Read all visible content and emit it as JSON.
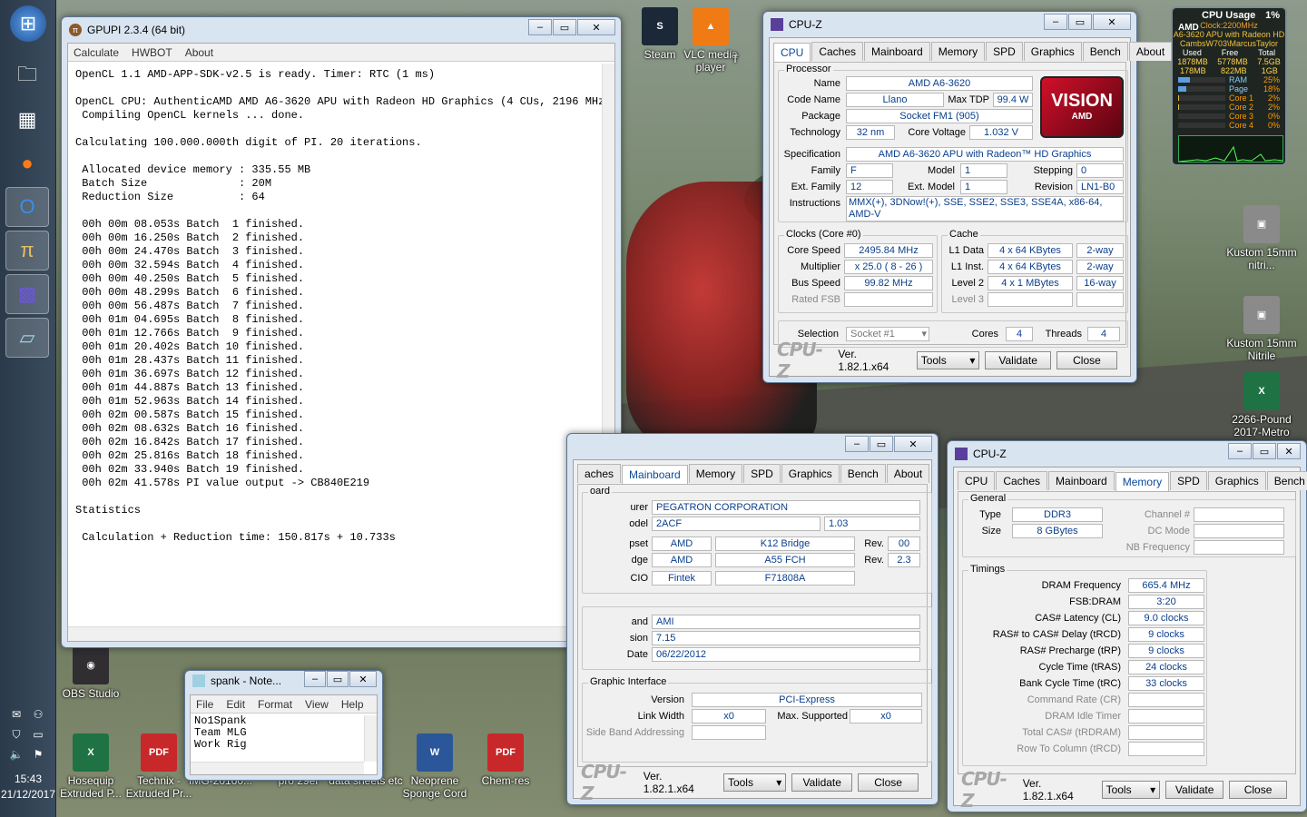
{
  "desktop": {
    "icons": [
      {
        "label": "Steam",
        "glyph": "S",
        "color": "#1b2838"
      },
      {
        "label": "VLC media player",
        "glyph": "▲",
        "color": "#f07b14"
      },
      {
        "label": "Kustom 15mm nitri...",
        "glyph": "▣",
        "color": "#8a8a8a"
      },
      {
        "label": "Kustom 15mm Nitrile",
        "glyph": "▣",
        "color": "#8a8a8a"
      },
      {
        "label": "2266-Pound 2017-Metro",
        "glyph": "X",
        "color": "#1f7244"
      },
      {
        "label": "OBS Studio",
        "glyph": "◉",
        "color": "#302e31"
      },
      {
        "label": "Hosequip Extruded P...",
        "glyph": "X",
        "color": "#1f7244"
      },
      {
        "label": "Technix - Extruded Pr...",
        "glyph": "PDF",
        "color": "#c8282a"
      },
      {
        "label": "IMG-20160...",
        "glyph": "",
        "color": "#777"
      },
      {
        "label": "pro 29er",
        "glyph": "",
        "color": "#777"
      },
      {
        "label": "data sheets etc",
        "glyph": "",
        "color": "#777"
      },
      {
        "label": "Neoprene Sponge Cord",
        "glyph": "W",
        "color": "#2b579a"
      },
      {
        "label": "Chem-res",
        "glyph": "PDF",
        "color": "#c8282a"
      }
    ],
    "top_icon_label_partial": "T"
  },
  "taskbar": {
    "time": "15:43",
    "date": "21/12/2017"
  },
  "gadget": {
    "title": "CPU Usage",
    "title_value": "1%",
    "brand": "AMD",
    "clock": "Clock:2200MHz",
    "cpu_name": "A6-3620 APU with Radeon HD",
    "user": "CambsW703\\MarcusTaylor",
    "mem_headers": [
      "Used",
      "Free",
      "Total"
    ],
    "mem_values": [
      "1878MB",
      "5778MB",
      "7.5GB"
    ],
    "page_values": [
      "178MB",
      "822MB",
      "1GB"
    ],
    "bars": [
      {
        "label": "RAM",
        "value": "25%",
        "fill": 0.25
      },
      {
        "label": "Page",
        "value": "18%",
        "fill": 0.18
      },
      {
        "label": "Core 1",
        "value": "2%",
        "fill": 0.02
      },
      {
        "label": "Core 2",
        "value": "2%",
        "fill": 0.02
      },
      {
        "label": "Core 3",
        "value": "0%",
        "fill": 0.0
      },
      {
        "label": "Core 4",
        "value": "0%",
        "fill": 0.0
      }
    ]
  },
  "gpupi": {
    "title": "GPUPI 2.3.4 (64 bit)",
    "menu": [
      "Calculate",
      "HWBOT",
      "About"
    ],
    "lines": [
      "OpenCL 1.1 AMD-APP-SDK-v2.5 is ready. Timer: RTC (1 ms)",
      "",
      "OpenCL CPU: AuthenticAMD AMD A6-3620 APU with Radeon HD Graphics (4 CUs, 2196 MHz)",
      " Compiling OpenCL kernels ... done.",
      "",
      "Calculating 100.000.000th digit of PI. 20 iterations.",
      "",
      " Allocated device memory : 335.55 MB",
      " Batch Size              : 20M",
      " Reduction Size          : 64",
      "",
      " 00h 00m 08.053s Batch  1 finished.",
      " 00h 00m 16.250s Batch  2 finished.",
      " 00h 00m 24.470s Batch  3 finished.",
      " 00h 00m 32.594s Batch  4 finished.",
      " 00h 00m 40.250s Batch  5 finished.",
      " 00h 00m 48.299s Batch  6 finished.",
      " 00h 00m 56.487s Batch  7 finished.",
      " 00h 01m 04.695s Batch  8 finished.",
      " 00h 01m 12.766s Batch  9 finished.",
      " 00h 01m 20.402s Batch 10 finished.",
      " 00h 01m 28.437s Batch 11 finished.",
      " 00h 01m 36.697s Batch 12 finished.",
      " 00h 01m 44.887s Batch 13 finished.",
      " 00h 01m 52.963s Batch 14 finished.",
      " 00h 02m 00.587s Batch 15 finished.",
      " 00h 02m 08.632s Batch 16 finished.",
      " 00h 02m 16.842s Batch 17 finished.",
      " 00h 02m 25.816s Batch 18 finished.",
      " 00h 02m 33.940s Batch 19 finished.",
      " 00h 02m 41.578s PI value output -> CB840E219",
      "",
      "Statistics",
      "",
      " Calculation + Reduction time: 150.817s + 10.733s"
    ]
  },
  "cpuz_cpu": {
    "title": "CPU-Z",
    "tabs": [
      "CPU",
      "Caches",
      "Mainboard",
      "Memory",
      "SPD",
      "Graphics",
      "Bench",
      "About"
    ],
    "processor_label": "Processor",
    "name_label": "Name",
    "name": "AMD A6-3620",
    "codename_label": "Code Name",
    "codename": "Llano",
    "maxtdp_label": "Max TDP",
    "maxtdp": "99.4 W",
    "package_label": "Package",
    "package": "Socket FM1 (905)",
    "tech_label": "Technology",
    "tech": "32 nm",
    "voltage_label": "Core Voltage",
    "voltage": "1.032 V",
    "spec_label": "Specification",
    "spec": "AMD A6-3620 APU with Radeon™ HD Graphics",
    "family_label": "Family",
    "family": "F",
    "model_label": "Model",
    "model": "1",
    "stepping_label": "Stepping",
    "stepping": "0",
    "extfamily_label": "Ext. Family",
    "extfamily": "12",
    "extmodel_label": "Ext. Model",
    "extmodel": "1",
    "revision_label": "Revision",
    "revision": "LN1-B0",
    "instr_label": "Instructions",
    "instr1": "MMX(+), 3DNow!(+), SSE, SSE2, SSE3, SSE4A, x86-64,",
    "instr2": "AMD-V",
    "logo_main": "VISION",
    "logo_sub": "AMD",
    "clocks_label": "Clocks (Core #0)",
    "corespeed_label": "Core Speed",
    "corespeed": "2495.84 MHz",
    "mult_label": "Multiplier",
    "mult": "x 25.0 ( 8 - 26 )",
    "bus_label": "Bus Speed",
    "bus": "99.82 MHz",
    "fsb_label": "Rated FSB",
    "cache_label": "Cache",
    "l1d_label": "L1 Data",
    "l1d": "4 x 64 KBytes",
    "l1d_way": "2-way",
    "l1i_label": "L1 Inst.",
    "l1i": "4 x 64 KBytes",
    "l1i_way": "2-way",
    "l2_label": "Level 2",
    "l2": "4 x 1 MBytes",
    "l2_way": "16-way",
    "l3_label": "Level 3",
    "sel_label": "Selection",
    "selection": "Socket #1",
    "cores_label": "Cores",
    "cores": "4",
    "threads_label": "Threads",
    "threads": "4",
    "version": "Ver. 1.82.1.x64",
    "tools": "Tools",
    "validate": "Validate",
    "close": "Close",
    "logo": "CPU-Z"
  },
  "cpuz_mb": {
    "tabs": [
      "aches",
      "Mainboard",
      "Memory",
      "SPD",
      "Graphics",
      "Bench",
      "About"
    ],
    "group1": "oard",
    "manuf_label": "urer",
    "manuf": "PEGATRON CORPORATION",
    "model_label": "odel",
    "model": "2ACF",
    "model_rev": "1.03",
    "chipset_label": "pset",
    "chipset_a": "AMD",
    "chipset_b": "K12 Bridge",
    "rev_label": "Rev.",
    "chipset_rev": "00",
    "south_label": "dge",
    "south_a": "AMD",
    "south_b": "A55 FCH",
    "south_rev": "2.3",
    "lpcio_label": "CIO",
    "lpcio_a": "Fintek",
    "lpcio_b": "F71808A",
    "brand_label": "and",
    "brand": "AMI",
    "bversion_label": "sion",
    "bversion": "7.15",
    "bdate_label": "Date",
    "bdate": "06/22/2012",
    "gi_label": "Graphic Interface",
    "giver_label": "Version",
    "giver": "PCI-Express",
    "lw_label": "Link Width",
    "lw": "x0",
    "ms_label": "Max. Supported",
    "ms": "x0",
    "sba_label": "Side Band Addressing",
    "version": "Ver. 1.82.1.x64",
    "tools": "Tools",
    "validate": "Validate",
    "close": "Close",
    "logo": "CPU-Z"
  },
  "cpuz_mem": {
    "title": "CPU-Z",
    "tabs": [
      "CPU",
      "Caches",
      "Mainboard",
      "Memory",
      "SPD",
      "Graphics",
      "Bench",
      "About"
    ],
    "general": "General",
    "type_label": "Type",
    "type": "DDR3",
    "size_label": "Size",
    "size": "8 GBytes",
    "channel_label": "Channel #",
    "dc_label": "DC Mode",
    "nb_label": "NB Frequency",
    "timings": "Timings",
    "rows": [
      {
        "label": "DRAM Frequency",
        "value": "665.4 MHz",
        "grey": false
      },
      {
        "label": "FSB:DRAM",
        "value": "3:20",
        "grey": false
      },
      {
        "label": "CAS# Latency (CL)",
        "value": "9.0 clocks",
        "grey": false
      },
      {
        "label": "RAS# to CAS# Delay (tRCD)",
        "value": "9 clocks",
        "grey": false
      },
      {
        "label": "RAS# Precharge (tRP)",
        "value": "9 clocks",
        "grey": false
      },
      {
        "label": "Cycle Time (tRAS)",
        "value": "24 clocks",
        "grey": false
      },
      {
        "label": "Bank Cycle Time (tRC)",
        "value": "33 clocks",
        "grey": false
      },
      {
        "label": "Command Rate (CR)",
        "value": "",
        "grey": true
      },
      {
        "label": "DRAM Idle Timer",
        "value": "",
        "grey": true
      },
      {
        "label": "Total CAS# (tRDRAM)",
        "value": "",
        "grey": true
      },
      {
        "label": "Row To Column (tRCD)",
        "value": "",
        "grey": true
      }
    ],
    "version": "Ver. 1.82.1.x64",
    "tools": "Tools",
    "validate": "Validate",
    "close": "Close",
    "logo": "CPU-Z"
  },
  "notepad": {
    "title": "spank - Note...",
    "menu": [
      "File",
      "Edit",
      "Format",
      "View",
      "Help"
    ],
    "lines": [
      "No1Spank",
      "Team MLG",
      "Work Rig"
    ]
  }
}
